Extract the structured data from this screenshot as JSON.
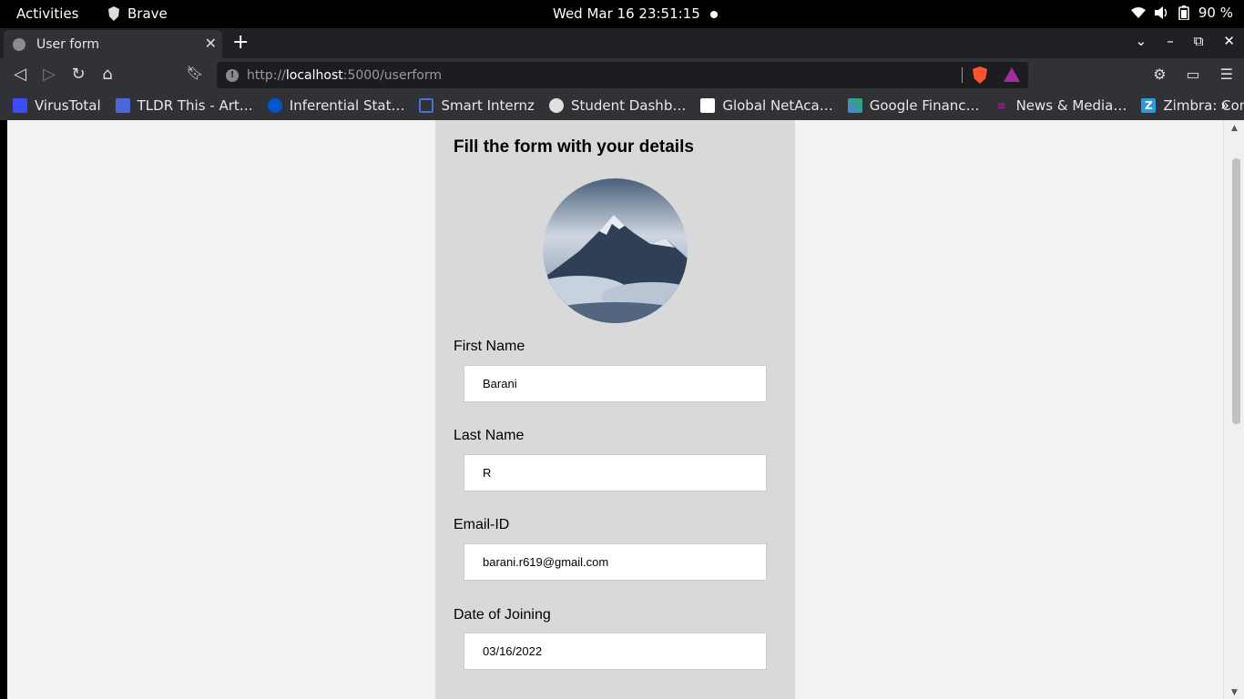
{
  "topbar": {
    "activities": "Activities",
    "app_name": "Brave",
    "clock": "Wed Mar 16  23:51:15",
    "battery": "90 %"
  },
  "browser": {
    "tab_title": "User form",
    "url_scheme": "http://",
    "url_host": "localhost",
    "url_path": ":5000/userform"
  },
  "bookmarks": [
    {
      "label": "VirusTotal",
      "color": "#394eff"
    },
    {
      "label": "TLDR This - Art…",
      "color": "#4a67d8"
    },
    {
      "label": "Inferential Stat…",
      "color": "#0056d2"
    },
    {
      "label": "Smart Internz",
      "color": "#4a6fd8"
    },
    {
      "label": "Student Dashb…",
      "color": "#e0e0e0"
    },
    {
      "label": "Global NetAca…",
      "color": "#1ba0d7"
    },
    {
      "label": "Google Financ…",
      "color": "#4285f4"
    },
    {
      "label": "News & Media…",
      "color": "#a02c9c"
    },
    {
      "label": "Zimbra: Comp…",
      "color": "#2c9ae0"
    }
  ],
  "form": {
    "heading": "Fill the form with your details",
    "first_name_label": "First Name",
    "first_name_value": "Barani",
    "last_name_label": "Last Name",
    "last_name_value": "R",
    "email_label": "Email-ID",
    "email_value": "barani.r619@gmail.com",
    "doj_label": "Date of Joining",
    "doj_value": "03/16/2022"
  }
}
